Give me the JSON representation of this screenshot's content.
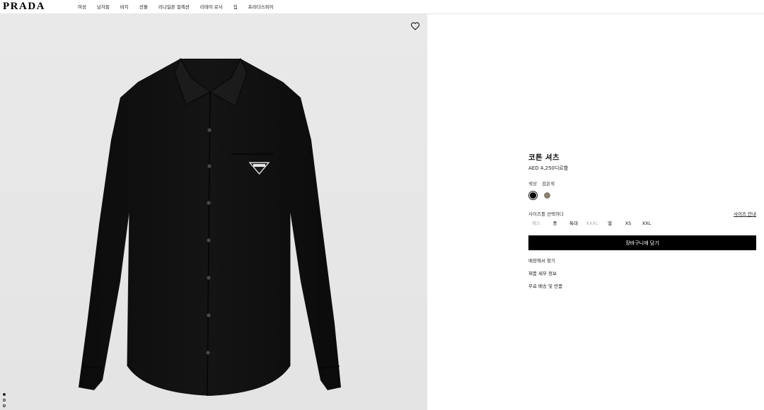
{
  "header": {
    "logo": "PRADA",
    "nav": [
      "여성",
      "남자들",
      "바지",
      "선물",
      "리나일론 컬렉션",
      "리테아 로사",
      "집",
      "프라다스피어"
    ]
  },
  "gallery": {
    "wishlist_icon": "heart-icon",
    "image_count": 3,
    "active_index": 0
  },
  "product": {
    "name": "코튼 셔츠",
    "price": "AED 4,250디르함",
    "color_label": "색상",
    "color_value": "검은색",
    "colors": [
      {
        "name": "black",
        "hex": "#000000",
        "selected": true
      },
      {
        "name": "taupe",
        "hex": "#8a8070",
        "selected": false
      }
    ],
    "size_label": "사이즈를 선택하다",
    "size_guide": "사이즈 안내",
    "sizes": [
      {
        "label": "에스",
        "available": false
      },
      {
        "label": "중",
        "available": true
      },
      {
        "label": "특대",
        "available": true
      },
      {
        "label": "XXXL",
        "available": false
      },
      {
        "label": "엘",
        "available": true
      },
      {
        "label": "XS",
        "available": true
      },
      {
        "label": "XXL",
        "available": true
      }
    ],
    "add_to_cart": "장바구니에 담기",
    "links": [
      "매장에서 찾기",
      "제품 세부 정보",
      "무료 배송 및 반품"
    ]
  }
}
